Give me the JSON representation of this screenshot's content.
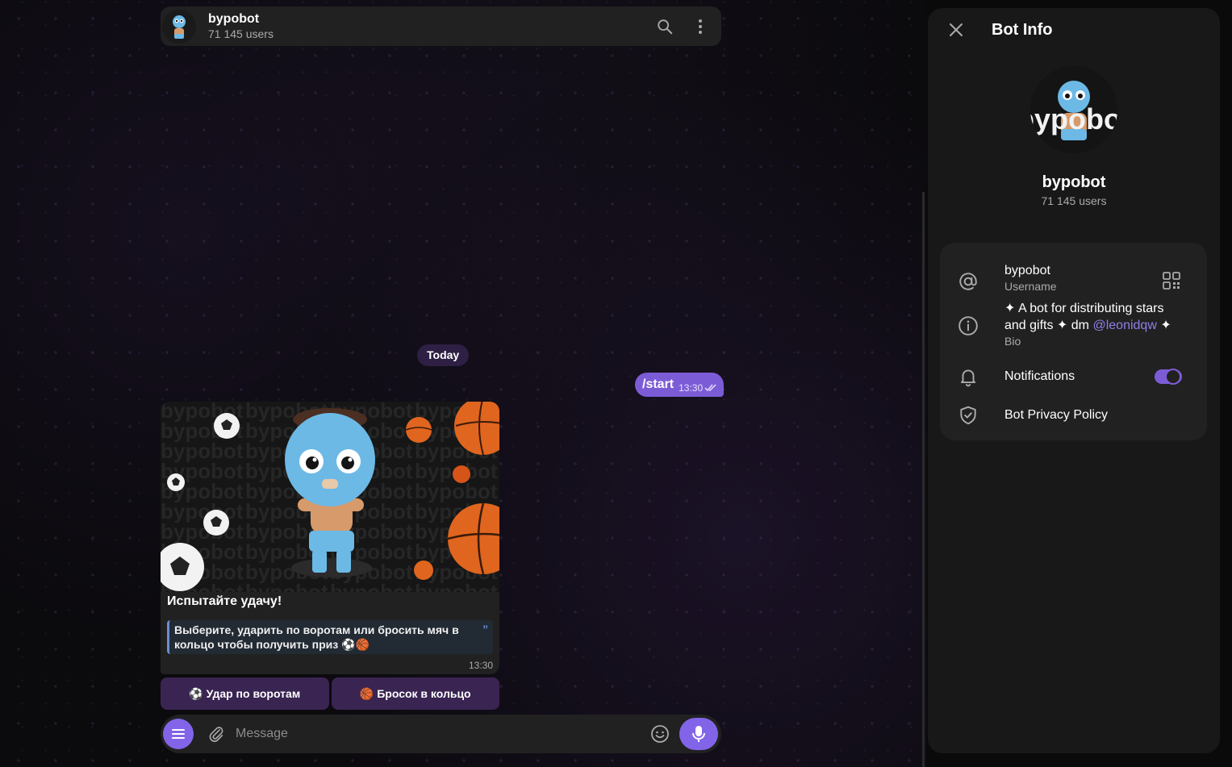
{
  "chat": {
    "name": "bypobot",
    "subtitle": "71 145 users",
    "avatar_text": "bypobot",
    "date_label": "Today"
  },
  "outgoing": {
    "text": "/start",
    "time": "13:30",
    "status_icon": "double-check-icon"
  },
  "bot_message": {
    "image_watermark": "bypobot",
    "title": "Испытайте удачу!",
    "quote": "Выберите, ударить по воротам или бросить мяч в кольцо чтобы получить приз ⚽🏀",
    "quote_icon": "quote-icon",
    "time": "13:30"
  },
  "keyboard": {
    "buttons": [
      {
        "label": "⚽ Удар по воротам"
      },
      {
        "label": "🏀 Бросок в кольцо"
      }
    ]
  },
  "composer": {
    "placeholder": "Message"
  },
  "panel": {
    "title": "Bot Info",
    "name": "bypobot",
    "subtitle": "71 145 users",
    "username": "bypobot",
    "username_label": "Username",
    "bio_main": "✦ A bot for distributing stars and gifts ✦ dm",
    "bio_mention": "@leonidqw",
    "bio_tail": "✦",
    "bio_label": "Bio",
    "notifications_label": "Notifications",
    "notifications_on": true,
    "privacy_label": "Bot Privacy Policy"
  },
  "colors": {
    "accent": "#8264e8",
    "outgoing_bubble": "#7c5cd6",
    "button_bg": "#3a2452",
    "panel_bg": "#181818",
    "card_bg": "#212121",
    "mention": "#8f7fe8",
    "quote_border": "#6a8ed1"
  }
}
